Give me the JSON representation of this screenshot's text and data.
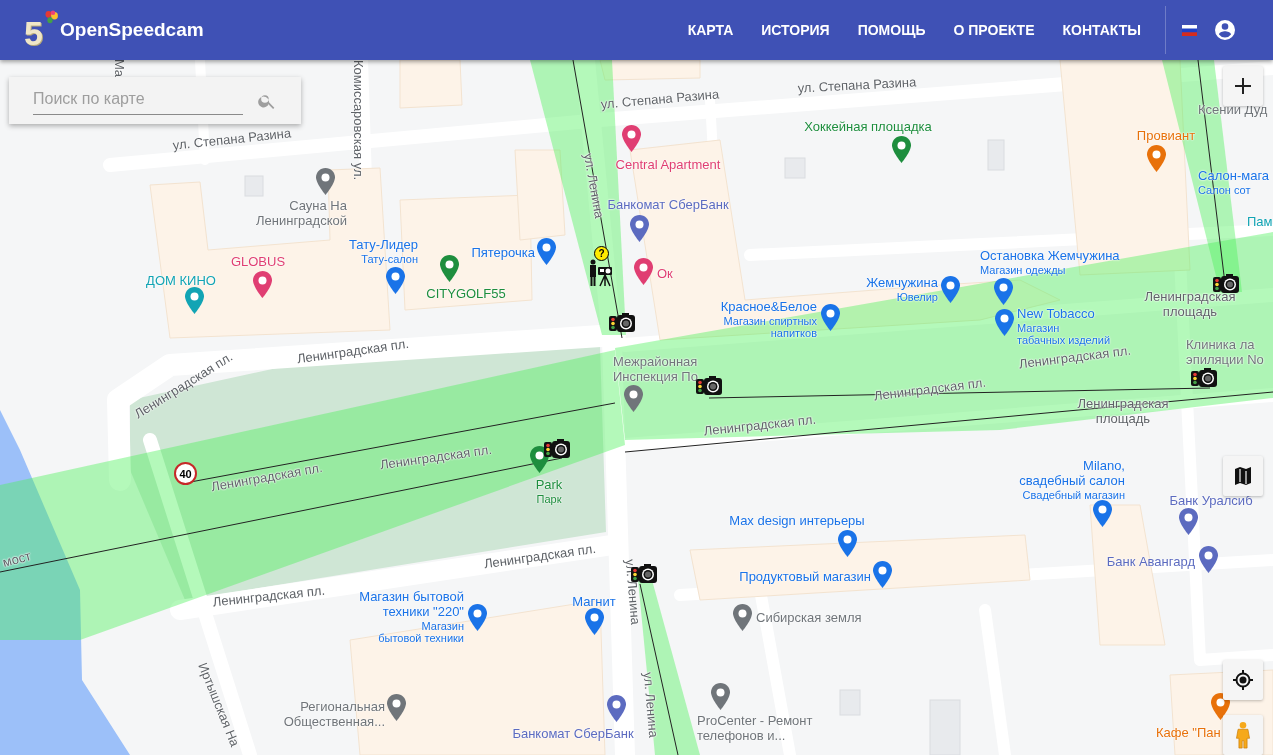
{
  "header": {
    "logo_digit": "5",
    "brand": "OpenSpeedcam",
    "nav": [
      {
        "label": "КАРТА"
      },
      {
        "label": "ИСТОРИЯ"
      },
      {
        "label": "ПОМОЩЬ"
      },
      {
        "label": "О ПРОЕКТЕ"
      },
      {
        "label": "КОНТАКТЫ"
      }
    ]
  },
  "search": {
    "placeholder": "Поиск по карте"
  },
  "map": {
    "streets": [
      {
        "name": "ул. Степана Разина"
      },
      {
        "name": "ул. Степана Разина"
      },
      {
        "name": "ул. Степана Разина"
      },
      {
        "name": "Комиссаровская ул."
      },
      {
        "name": "Ма"
      },
      {
        "name": "ул. Ленина"
      },
      {
        "name": "Ленинградская пл."
      },
      {
        "name": "Ленинградская пл."
      },
      {
        "name": "Ленинградская пл."
      },
      {
        "name": "Ленинградская пл."
      },
      {
        "name": "Ленинградская пл."
      },
      {
        "name": "Ленинградская пл."
      },
      {
        "name": "Ленинградская пл."
      },
      {
        "name": "Ленинградская\nплощадь"
      },
      {
        "name": "Ленинградская\nплощадь"
      },
      {
        "name": "Ленинградская пл."
      },
      {
        "name": "Ленинградская пл."
      },
      {
        "name": "мост"
      },
      {
        "name": "Иртышская На"
      },
      {
        "name": "ул. Ленина"
      },
      {
        "name": "ул. Ленина"
      }
    ],
    "places": [
      {
        "name": "Ксении Дуд",
        "color": "#70757a",
        "pin": false
      },
      {
        "name": "Хоккейная площадка",
        "color": "#1e8e3e",
        "pin": true
      },
      {
        "name": "Провиант",
        "color": "#e8710a",
        "pin": true
      },
      {
        "name": "Central Apartment",
        "color": "#e03e72",
        "pin": true
      },
      {
        "name": "Салон-мага",
        "category": "Салон сот",
        "color": "#1a73e8",
        "pin": false
      },
      {
        "name": "Сауна На\nЛенинградской",
        "color": "#70757a",
        "pin": true
      },
      {
        "name": "Банкомат СберБанк",
        "color": "#5c6bc0",
        "pin": true
      },
      {
        "name": "Пам",
        "color": "#12a4b4",
        "pin": false
      },
      {
        "name": "GLOBUS",
        "color": "#e03e72",
        "pin": true
      },
      {
        "name": "Тату-Лидер",
        "category": "Тату-салон",
        "color": "#1a73e8",
        "pin": true
      },
      {
        "name": "Пятерочка",
        "color": "#1a73e8",
        "pin": true
      },
      {
        "name": "Остановка Жемчужина",
        "category": "Магазин одежды",
        "color": "#1a73e8",
        "pin": true
      },
      {
        "name": "ДОМ КИНО",
        "color": "#12a4b4",
        "pin": true
      },
      {
        "name": "CITYGOLF55",
        "color": "#1e8e3e",
        "pin": true
      },
      {
        "name": "Ок",
        "color": "#e03e72",
        "pin": true
      },
      {
        "name": "Жемчужина",
        "category": "Ювелир",
        "color": "#1a73e8",
        "pin": true
      },
      {
        "name": "Красное&Белое",
        "category": "Магазин спиртных\nнапитков",
        "color": "#1a73e8",
        "pin": true
      },
      {
        "name": "New Tobacco",
        "category": "Магазин\nтабачных изделий",
        "color": "#1a73e8",
        "pin": true
      },
      {
        "name": "Клиника ла\nэпиляции No",
        "color": "#70757a",
        "pin": false
      },
      {
        "name": "Межрайонная\nИнспекция По",
        "color": "#70757a",
        "pin": true
      },
      {
        "name": "Park",
        "category": "Парк",
        "color": "#1e8e3e",
        "pin": true
      },
      {
        "name": "Milano,\nсвадебный салон",
        "category": "Свадебный магазин",
        "color": "#1a73e8",
        "pin": true
      },
      {
        "name": "Банк Уралсиб",
        "color": "#5c6bc0",
        "pin": true
      },
      {
        "name": "Max design интерьеры",
        "color": "#1a73e8",
        "pin": true
      },
      {
        "name": "Банк Авангард",
        "color": "#5c6bc0",
        "pin": true
      },
      {
        "name": "Продуктовый магазин",
        "color": "#1a73e8",
        "pin": true
      },
      {
        "name": "Магазин бытовой\nтехники \"220\"",
        "category": "Магазин\nбытовой техники",
        "color": "#1a73e8",
        "pin": true
      },
      {
        "name": "Магнит",
        "color": "#1a73e8",
        "pin": true
      },
      {
        "name": "Сибирская земля",
        "color": "#70757a",
        "pin": true
      },
      {
        "name": "Региональная\nОбщественная...",
        "color": "#70757a",
        "pin": true
      },
      {
        "name": "Банкомат СберБанк",
        "color": "#5c6bc0",
        "pin": true
      },
      {
        "name": "ProCenter - Ремонт\nтелефонов и...",
        "color": "#70757a",
        "pin": true
      },
      {
        "name": "Кафе \"Пан",
        "color": "#e8710a",
        "pin": true
      }
    ],
    "speed_limit": "40",
    "camera_badge": "?"
  }
}
